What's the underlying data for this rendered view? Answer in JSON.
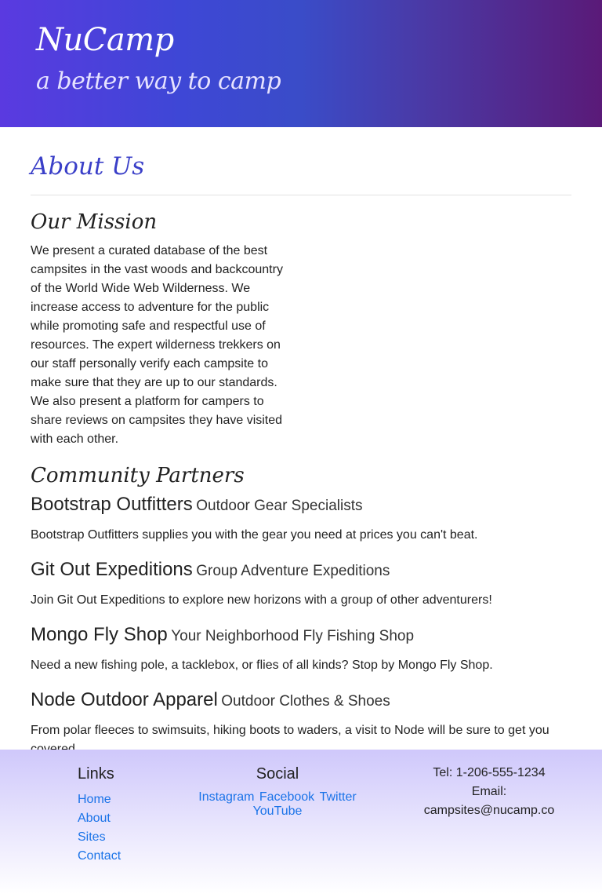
{
  "header": {
    "brand": "NuCamp",
    "tagline": "a better way to camp"
  },
  "page": {
    "title": "About Us"
  },
  "mission": {
    "heading": "Our Mission",
    "text": "We present a curated database of the best campsites in the vast woods and backcountry of the World Wide Web Wilderness. We increase access to adventure for the public while promoting safe and respectful use of resources. The expert wilderness trekkers on our staff personally verify each campsite to make sure that they are up to our standards. We also present a platform for campers to share reviews on campsites they have visited with each other."
  },
  "partners": {
    "heading": "Community Partners",
    "items": [
      {
        "name": "Bootstrap Outfitters",
        "subtitle": "Outdoor Gear Specialists",
        "description": "Bootstrap Outfitters supplies you with the gear you need at prices you can't beat."
      },
      {
        "name": "Git Out Expeditions",
        "subtitle": "Group Adventure Expeditions",
        "description": "Join Git Out Expeditions to explore new horizons with a group of other adventurers!"
      },
      {
        "name": "Mongo Fly Shop",
        "subtitle": "Your Neighborhood Fly Fishing Shop",
        "description": "Need a new fishing pole, a tacklebox, or flies of all kinds? Stop by Mongo Fly Shop."
      },
      {
        "name": "Node Outdoor Apparel",
        "subtitle": "Outdoor Clothes & Shoes",
        "description": "From polar fleeces to swimsuits, hiking boots to waders, a visit to Node will be sure to get you covered."
      }
    ]
  },
  "footer": {
    "links_heading": "Links",
    "links": [
      "Home",
      "About",
      "Sites",
      "Contact"
    ],
    "social_heading": "Social",
    "social": [
      "Instagram",
      "Facebook",
      "Twitter",
      "YouTube"
    ],
    "contact": {
      "tel": "Tel: 1-206-555-1234",
      "email_label": "Email:",
      "email": "campsites@nucamp.co"
    }
  },
  "colors": {
    "link": "#1a73e8",
    "title": "#3a3fc8"
  }
}
